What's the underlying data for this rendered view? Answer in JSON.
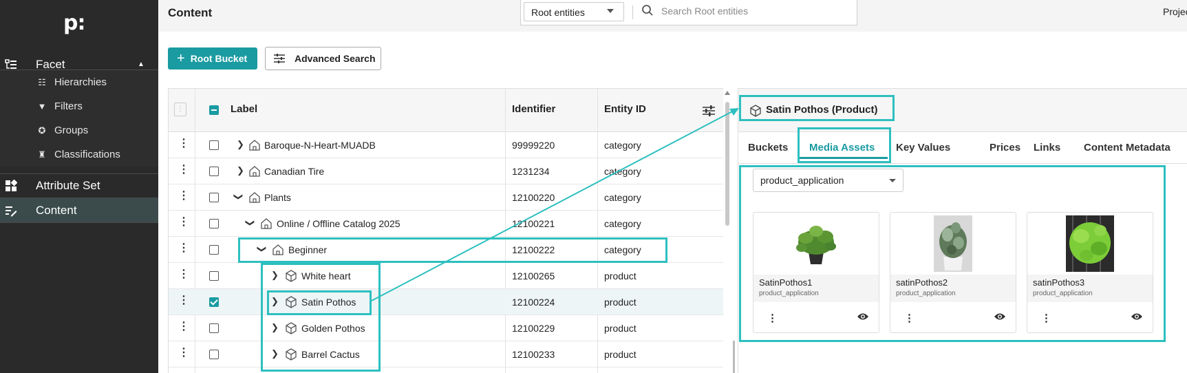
{
  "sidebar": {
    "logo": "p:",
    "items": [
      {
        "label": "Facet",
        "icon": "facet-icon"
      },
      {
        "label": "Hierarchies",
        "icon": "hierarchy-icon"
      },
      {
        "label": "Filters",
        "icon": "filter-icon"
      },
      {
        "label": "Groups",
        "icon": "groups-icon"
      },
      {
        "label": "Classifications",
        "icon": "classification-icon"
      },
      {
        "label": "Attribute Set",
        "icon": "attribute-set-icon"
      },
      {
        "label": "Content",
        "icon": "content-icon"
      }
    ]
  },
  "header": {
    "title": "Content",
    "root_select": "Root entities",
    "search_placeholder": "Search Root entities",
    "project": "Projec"
  },
  "toolbar": {
    "root_bucket": "Root Bucket",
    "advanced_search": "Advanced Search"
  },
  "table": {
    "columns": [
      "Label",
      "Identifier",
      "Entity ID"
    ],
    "rows": [
      {
        "label": "Baroque-N-Heart-MUADB",
        "identifier": "99999220",
        "entity": "category"
      },
      {
        "label": "Canadian Tire",
        "identifier": "1231234",
        "entity": "category"
      },
      {
        "label": "Plants",
        "identifier": "12100220",
        "entity": "category"
      },
      {
        "label": "Online / Offline Catalog 2025",
        "identifier": "12100221",
        "entity": "category"
      },
      {
        "label": "Beginner",
        "identifier": "12100222",
        "entity": "category"
      },
      {
        "label": "White heart",
        "identifier": "12100265",
        "entity": "product"
      },
      {
        "label": "Satin Pothos",
        "identifier": "12100224",
        "entity": "product"
      },
      {
        "label": "Golden Pothos",
        "identifier": "12100229",
        "entity": "product"
      },
      {
        "label": "Barrel Cactus",
        "identifier": "12100233",
        "entity": "product"
      }
    ]
  },
  "panel": {
    "title": "Satin Pothos (Product)",
    "tabs": [
      "Buckets",
      "Media Assets",
      "Key Values",
      "Prices",
      "Links",
      "Content Metadata"
    ],
    "asset_type": "product_application",
    "assets": [
      {
        "name": "SatinPothos1",
        "type": "product_application"
      },
      {
        "name": "satinPothos2",
        "type": "product_application"
      },
      {
        "name": "satinPothos3",
        "type": "product_application"
      }
    ]
  },
  "colors": {
    "accent": "#1a9ba1",
    "highlight": "#2dbfbf",
    "sidebar": "#2a2a2a"
  }
}
